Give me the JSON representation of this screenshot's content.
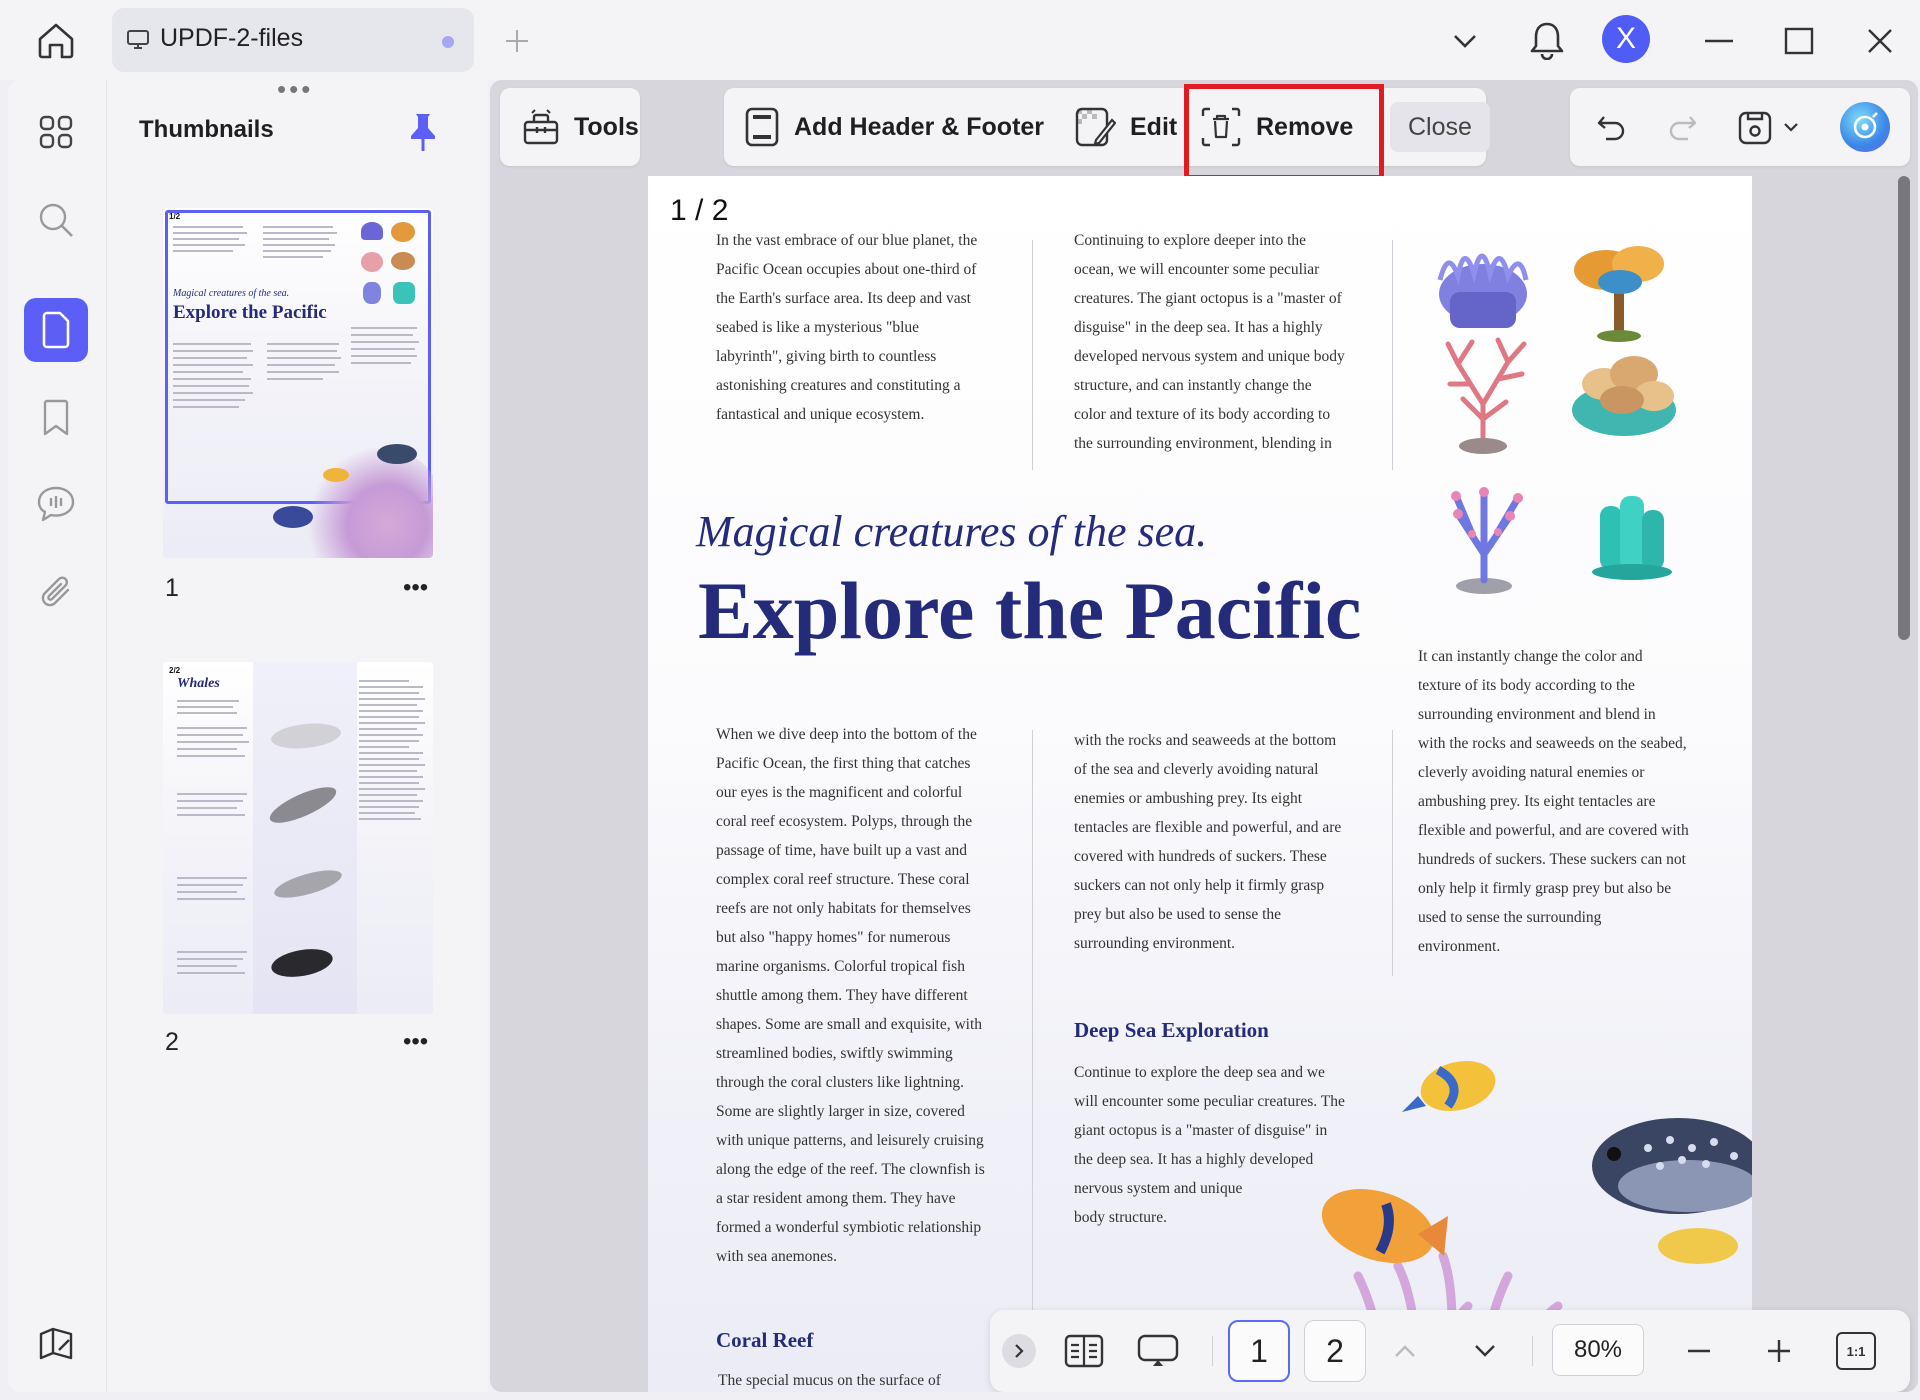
{
  "tab": {
    "title": "UPDF-2-files"
  },
  "user": {
    "initial": "X"
  },
  "sidebar": {
    "title": "Thumbnails"
  },
  "thumbnails": [
    {
      "number": "1",
      "more": "•••",
      "page_label": "1/2",
      "subtitle": "Magical creatures of the sea.",
      "headline": "Explore the Pacific"
    },
    {
      "number": "2",
      "more": "•••",
      "page_label": "2/2",
      "headline": "Whales"
    }
  ],
  "toolbar": {
    "tools": "Tools",
    "add_header_footer": "Add Header & Footer",
    "edit": "Edit",
    "remove": "Remove",
    "close": "Close"
  },
  "page": {
    "label": "1 / 2",
    "col1_top": [
      "In the vast embrace of our blue planet, the",
      "Pacific Ocean occupies about one-third of",
      "the Earth's surface area. Its deep and vast",
      "seabed is like a mysterious \"blue",
      "labyrinth\", giving birth to countless",
      "astonishing creatures and constituting a",
      "fantastical and unique ecosystem."
    ],
    "col2_top": [
      "Continuing to explore deeper into the",
      "ocean, we will encounter some peculiar",
      "creatures. The giant octopus is a \"master of",
      "disguise\" in the deep sea. It has a highly",
      "developed nervous system and unique body",
      "structure, and can instantly change the",
      "color and texture of its body according to",
      "the surrounding environment, blending in"
    ],
    "subtitle": "Magical creatures of the sea.",
    "headline": "Explore the Pacific",
    "col3": [
      "It can instantly change the color and",
      "texture of its body according to the",
      "surrounding environment and blend in",
      "with the rocks and seaweeds on the seabed,",
      "cleverly avoiding natural enemies or",
      "ambushing prey. Its eight tentacles are",
      "flexible and powerful, and are covered with",
      "hundreds of suckers. These suckers can not",
      "only help it firmly grasp prey but also be",
      "used to sense the surrounding",
      "environment."
    ],
    "col1_bottom": [
      "When we dive deep into the bottom of the",
      "Pacific Ocean, the first thing that catches",
      "our eyes is the magnificent and colorful",
      "coral reef ecosystem. Polyps, through the",
      "passage of time, have built up a vast and",
      "complex coral reef structure. These coral",
      "reefs are not only habitats for themselves",
      "but also \"happy homes\" for numerous",
      "marine organisms. Colorful tropical fish",
      "shuttle among them. They have different",
      "shapes. Some are small and exquisite, with",
      "streamlined bodies, swiftly swimming",
      "through the coral clusters like lightning.",
      "Some are slightly larger in size, covered",
      "with unique patterns, and leisurely cruising",
      "along the edge of the reef. The clownfish is",
      "a star resident among them. They have",
      "formed a wonderful symbiotic relationship",
      "with sea anemones."
    ],
    "col2_mid": [
      "with the rocks and seaweeds at the bottom",
      "of the sea and cleverly avoiding natural",
      "enemies or ambushing prey. Its eight",
      "tentacles are flexible and powerful, and are",
      "covered with hundreds of suckers. These",
      "suckers can not only help it firmly grasp",
      "prey but also be used to sense the",
      "surrounding environment."
    ],
    "deep_sea_heading": "Deep Sea Exploration",
    "deep_sea_text": [
      "Continue to explore the deep sea and we",
      "will encounter some peculiar creatures. The",
      "giant octopus is a \"master of disguise\" in",
      "the deep sea. It has a highly developed",
      "nervous system and unique",
      "body structure."
    ],
    "coral_heading": "Coral Reef",
    "coral_text": [
      "The special mucus on the surface of"
    ]
  },
  "bottombar": {
    "page1": "1",
    "page2": "2",
    "zoom": "80%",
    "fit_label": "1:1"
  },
  "colors": {
    "accent": "#5b5ff6",
    "headline": "#232b7a",
    "highlight_box": "#e11b22"
  },
  "icons": [
    "home-icon",
    "monitor-icon",
    "plus-icon",
    "chevron-down-icon",
    "bell-icon",
    "minimize-icon",
    "maximize-icon",
    "close-icon",
    "grid-icon",
    "search-icon",
    "page-icon",
    "bookmark-icon",
    "comment-icon",
    "paperclip-icon",
    "layout-icon",
    "pin-icon",
    "toolbox-icon",
    "header-footer-icon",
    "edit-icon",
    "remove-icon",
    "undo-icon",
    "redo-icon",
    "save-icon",
    "ai-assistant-icon",
    "chevron-right-icon",
    "two-page-icon",
    "presentation-icon",
    "chevron-up-icon",
    "minus-icon",
    "fit-icon"
  ]
}
